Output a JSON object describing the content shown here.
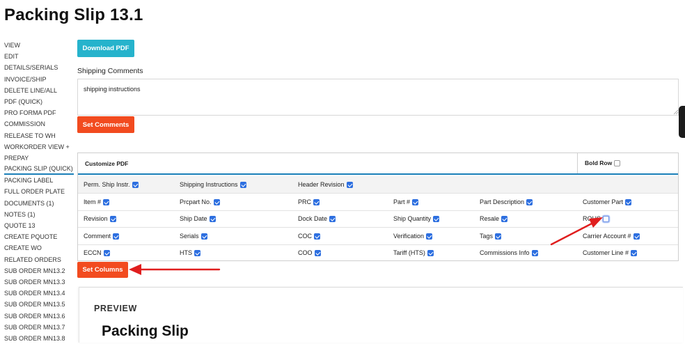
{
  "page": {
    "title": "Packing Slip 13.1"
  },
  "sidebar": {
    "items": [
      "VIEW",
      "EDIT",
      "DETAILS/SERIALS",
      "INVOICE/SHIP",
      "DELETE LINE/ALL",
      "PDF (QUICK)",
      "PRO FORMA PDF",
      "COMMISSION",
      "RELEASE TO WH",
      "WORKORDER VIEW +",
      "PREPAY",
      "PACKING SLIP (QUICK)",
      "PACKING LABEL",
      "FULL ORDER PLATE",
      "DOCUMENTS (1)",
      "NOTES (1)",
      "QUOTE 13",
      "CREATE PQUOTE",
      "CREATE WO",
      "RELATED ORDERS",
      "SUB ORDER MN13.2",
      "SUB ORDER MN13.3",
      "SUB ORDER MN13.4",
      "SUB ORDER MN13.5",
      "SUB ORDER MN13.6",
      "SUB ORDER MN13.7",
      "SUB ORDER MN13.8"
    ],
    "active": "PACKING SLIP (QUICK)"
  },
  "toolbar": {
    "download_pdf": "Download PDF"
  },
  "comments": {
    "label": "Shipping Comments",
    "value": "shipping instructions",
    "button": "Set Comments"
  },
  "customize": {
    "title": "Customize PDF",
    "bold_row": {
      "label": "Bold Row",
      "checked": false
    },
    "rows": [
      [
        {
          "label": "Perm. Ship Instr.",
          "checked": true
        },
        {
          "label": "Shipping Instructions",
          "checked": true
        },
        {
          "label": "Header Revision",
          "checked": true
        }
      ],
      [
        {
          "label": "Item #",
          "checked": true
        },
        {
          "label": "Prcpart No.",
          "checked": true
        },
        {
          "label": "PRC",
          "checked": true
        },
        {
          "label": "Part #",
          "checked": true
        },
        {
          "label": "Part Description",
          "checked": true
        },
        {
          "label": "Customer Part",
          "checked": true
        }
      ],
      [
        {
          "label": "Revision",
          "checked": true
        },
        {
          "label": "Ship Date",
          "checked": true
        },
        {
          "label": "Dock Date",
          "checked": true
        },
        {
          "label": "Ship Quantity",
          "checked": true
        },
        {
          "label": "Resale",
          "checked": true
        },
        {
          "label": "ROHS",
          "checked": false
        }
      ],
      [
        {
          "label": "Comment",
          "checked": true
        },
        {
          "label": "Serials",
          "checked": true
        },
        {
          "label": "COC",
          "checked": true
        },
        {
          "label": "Verification",
          "checked": true
        },
        {
          "label": "Tags",
          "checked": true
        },
        {
          "label": "Carrier Account #",
          "checked": true
        }
      ],
      [
        {
          "label": "ECCN",
          "checked": true
        },
        {
          "label": "HTS",
          "checked": true
        },
        {
          "label": "COO",
          "checked": true
        },
        {
          "label": "Tariff (HTS)",
          "checked": true
        },
        {
          "label": "Commissions Info",
          "checked": true
        },
        {
          "label": "Customer Line #",
          "checked": true
        }
      ]
    ],
    "set_columns": "Set Columns"
  },
  "preview": {
    "label": "PREVIEW",
    "title": "Packing Slip"
  },
  "colors": {
    "accent": "#1a7fb8",
    "download_button": "#26b3cc",
    "action_button": "#f24b1f",
    "checkbox": "#2d6fe0",
    "annotation_arrow": "#e01e1e"
  }
}
